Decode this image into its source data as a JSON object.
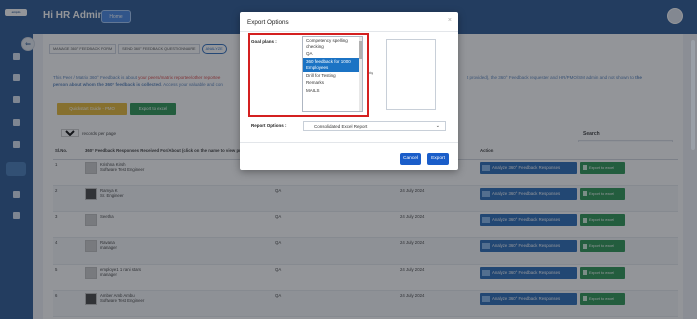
{
  "app": {
    "title": "Hi HR Admin",
    "home_label": "Home",
    "logo_text": "emplo"
  },
  "tabs": [
    {
      "label": "MANAGE 360° FEEDBACK FORM"
    },
    {
      "label": "SEND 360° FEEDBACK QUESTIONNAIRE"
    },
    {
      "label": "ANALYZE"
    }
  ],
  "info": {
    "line1_start": "This Peer / Matrix 360° Feedback is about ",
    "line1_red": "your peers/matrix reportee/other reportee",
    "line2_start": "person about whom the 360° feedback is collected",
    "line2_rest": ". Access your valuable and con",
    "tail_start": "t provided), the 360° Feedback requester and HR/PMO/SM admin and not shown to ",
    "tail_bold": "the"
  },
  "buttons": {
    "quick": "Quickstart Guide - PMO",
    "export_excel": "Export to excel"
  },
  "records": {
    "value": "25",
    "label": "records per page"
  },
  "search_label": "Search",
  "table": {
    "headers": {
      "sl": "Sl.No.",
      "resp": "360° Feedback Responses Received For/About (click on the name to view profile)",
      "action": "Action"
    },
    "rows": [
      {
        "sl": "1",
        "name": "Krishna Kirsh",
        "role": "Software Test Engineer",
        "dept": "",
        "date": ""
      },
      {
        "sl": "2",
        "name": "Ramya K",
        "role": "Sr. Engineer",
        "dept": "QA",
        "date": "24 July 2024"
      },
      {
        "sl": "3",
        "name": "Seetha",
        "role": "",
        "dept": "QA",
        "date": "24 July 2024"
      },
      {
        "sl": "4",
        "name": "Ravana",
        "role": "manager",
        "dept": "QA",
        "date": "24 July 2024"
      },
      {
        "sl": "5",
        "name": "employe1 1 rani stars",
        "role": "manager",
        "dept": "QA",
        "date": "24 July 2024"
      },
      {
        "sl": "6",
        "name": "Amber Amb Ambu",
        "role": "Software Test Engineer",
        "dept": "QA",
        "date": "24 July 2024"
      }
    ],
    "analyze_label": "Analyze 360° Feedback Responses",
    "export_label": "Export to excel"
  },
  "modal": {
    "title": "Export Options",
    "close": "×",
    "goal_label": "Goal plans :",
    "goal_options": [
      {
        "label": "Competency spelling checking",
        "selected": false
      },
      {
        "label": "QA",
        "selected": false
      },
      {
        "label": "360 feedback for 1000 Employees",
        "selected": true
      },
      {
        "label": "Drill for Testing",
        "selected": false
      },
      {
        "label": "Remarks",
        "selected": false
      },
      {
        "label": "MAILS",
        "selected": false
      }
    ],
    "report_label": "Report Options :",
    "report_value": "Consolidated Excel Report",
    "cancel": "Cancel",
    "export": "Export"
  },
  "colors": {
    "primary": "#1f4f8c",
    "accent": "#1a5dc9",
    "green": "#1f8f48",
    "yellow": "#e4b52a",
    "highlight": "#d42020"
  }
}
